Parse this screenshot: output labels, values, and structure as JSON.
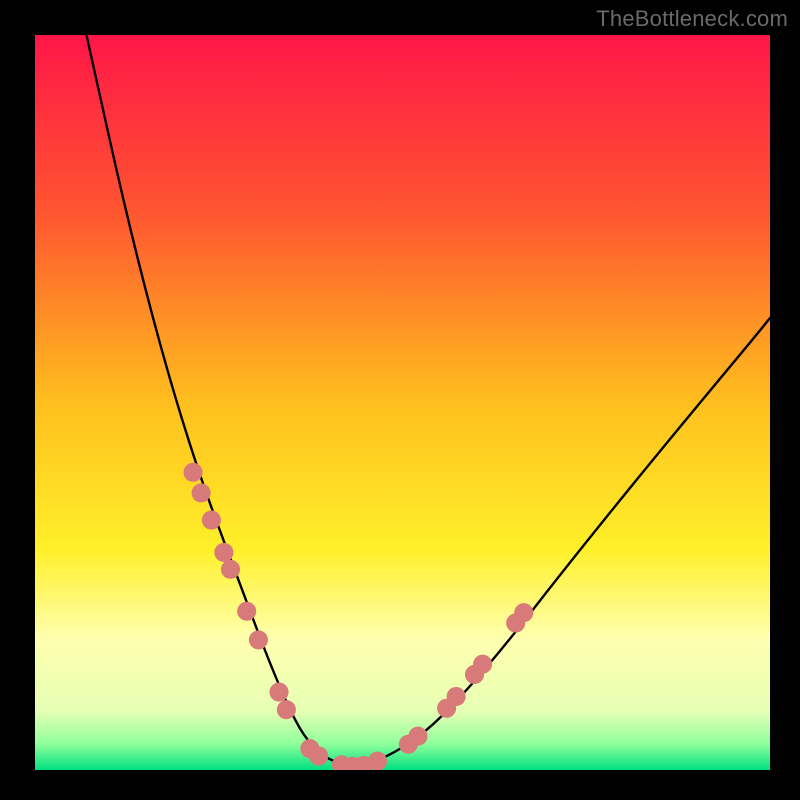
{
  "watermark": "TheBottleneck.com",
  "chart_data": {
    "type": "line",
    "title": "",
    "xlabel": "",
    "ylabel": "",
    "xlim": [
      0,
      100
    ],
    "ylim": [
      0,
      100
    ],
    "gradient_stops": [
      {
        "offset": 0.0,
        "color": "#ff1648"
      },
      {
        "offset": 0.24,
        "color": "#ff5530"
      },
      {
        "offset": 0.5,
        "color": "#ffbf1e"
      },
      {
        "offset": 0.7,
        "color": "#fff02a"
      },
      {
        "offset": 0.82,
        "color": "#ffffae"
      },
      {
        "offset": 0.92,
        "color": "#e6ffb4"
      },
      {
        "offset": 0.965,
        "color": "#8dff9b"
      },
      {
        "offset": 1.0,
        "color": "#00e080"
      }
    ],
    "series": [
      {
        "name": "bottleneck-curve",
        "x": [
          7,
          9,
          11,
          13,
          15,
          17,
          19,
          21,
          23,
          25,
          26.5,
          28,
          29.5,
          31,
          33,
          35,
          37,
          40,
          44,
          48,
          53,
          58,
          64,
          71,
          79,
          88,
          98,
          100
        ],
        "y": [
          100,
          91,
          82,
          73.5,
          65.5,
          58,
          51,
          44.5,
          38.5,
          33,
          29,
          25,
          21,
          17,
          12,
          7.5,
          4,
          1.2,
          0.5,
          1.8,
          5,
          10,
          17,
          26,
          36,
          47,
          59,
          61.5
        ]
      }
    ],
    "marker_points": {
      "name": "curve-markers",
      "color": "#d87a7a",
      "radius_frac": 0.013,
      "points": [
        {
          "x": 21.5,
          "y": 40.5
        },
        {
          "x": 22.6,
          "y": 37.7
        },
        {
          "x": 24.0,
          "y": 34.0
        },
        {
          "x": 25.7,
          "y": 29.6
        },
        {
          "x": 26.6,
          "y": 27.3
        },
        {
          "x": 28.8,
          "y": 21.6
        },
        {
          "x": 30.4,
          "y": 17.7
        },
        {
          "x": 33.2,
          "y": 10.6
        },
        {
          "x": 34.2,
          "y": 8.2
        },
        {
          "x": 37.4,
          "y": 2.9
        },
        {
          "x": 38.6,
          "y": 1.9
        },
        {
          "x": 41.7,
          "y": 0.7
        },
        {
          "x": 43.2,
          "y": 0.5
        },
        {
          "x": 44.7,
          "y": 0.6
        },
        {
          "x": 46.6,
          "y": 1.2
        },
        {
          "x": 50.8,
          "y": 3.5
        },
        {
          "x": 52.1,
          "y": 4.6
        },
        {
          "x": 56.0,
          "y": 8.4
        },
        {
          "x": 57.3,
          "y": 10.0
        },
        {
          "x": 59.8,
          "y": 13.0
        },
        {
          "x": 60.9,
          "y": 14.4
        },
        {
          "x": 65.4,
          "y": 20.0
        },
        {
          "x": 66.5,
          "y": 21.4
        }
      ]
    }
  }
}
